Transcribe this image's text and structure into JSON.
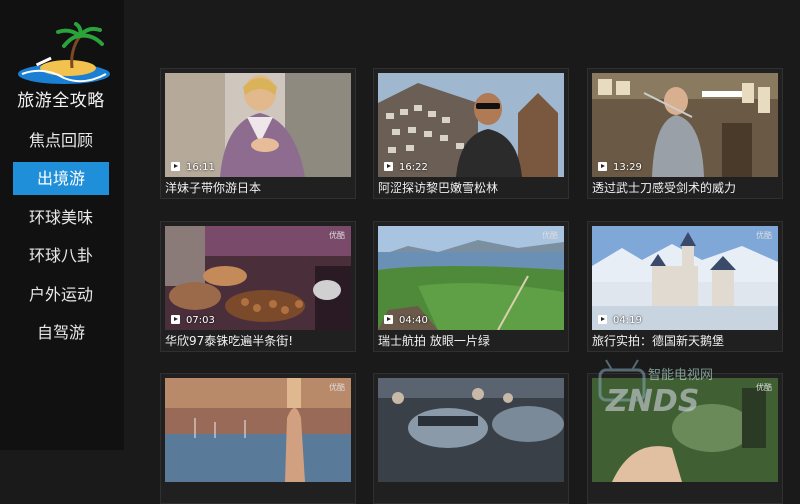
{
  "app": {
    "title": "旅游全攻略"
  },
  "nav": {
    "items": [
      {
        "label": "焦点回顾"
      },
      {
        "label": "出境游"
      },
      {
        "label": "环球美味"
      },
      {
        "label": "环球八卦"
      },
      {
        "label": "户外运动"
      },
      {
        "label": "自驾游"
      }
    ],
    "active_index": 1
  },
  "videos": [
    {
      "title": "洋妹子带你游日本",
      "duration": "16:11",
      "badge": ""
    },
    {
      "title": "阿涩探访黎巴嫩雪松林",
      "duration": "16:22",
      "badge": ""
    },
    {
      "title": "透过武士刀感受剑术的威力",
      "duration": "13:29",
      "badge": ""
    },
    {
      "title": "华欣97泰铢吃遍半条街!",
      "duration": "07:03",
      "badge": "优酷"
    },
    {
      "title": "瑞士航拍 放眼一片绿",
      "duration": "04:40",
      "badge": "优酷"
    },
    {
      "title": "旅行实拍：德国新天鹅堡",
      "duration": "04:19",
      "badge": "优酷"
    },
    {
      "title": "",
      "duration": "",
      "badge": "优酷"
    },
    {
      "title": "",
      "duration": "",
      "badge": ""
    },
    {
      "title": "",
      "duration": "",
      "badge": "优酷"
    }
  ],
  "watermark": {
    "text_cn": "智能电视网",
    "text_en": "ZNDS"
  },
  "colors": {
    "accent": "#1e8fd8",
    "background": "#1a1a1a",
    "sidebar": "#111111"
  }
}
